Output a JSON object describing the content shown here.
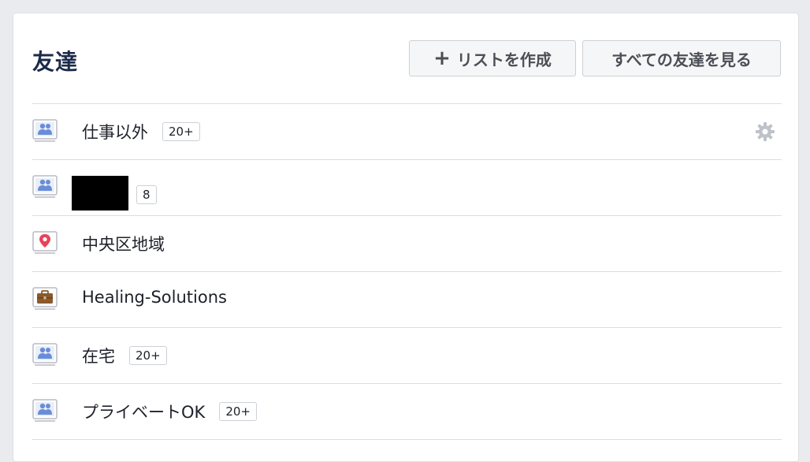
{
  "header": {
    "title": "友達",
    "create_list_label": "リストを作成",
    "see_all_label": "すべての友達を見る"
  },
  "lists": [
    {
      "label": "仕事以外",
      "badge": "20+",
      "icon": "friends-list-icon",
      "gear": true
    },
    {
      "label": "",
      "badge": "8",
      "icon": "friends-list-icon",
      "redacted": true
    },
    {
      "label": "中央区地域",
      "badge": "",
      "icon": "location-pin-icon"
    },
    {
      "label": "Healing-Solutions",
      "badge": "",
      "icon": "briefcase-icon"
    },
    {
      "label": "在宅",
      "badge": "20+",
      "icon": "friends-list-icon"
    },
    {
      "label": "プライベートOK",
      "badge": "20+",
      "icon": "friends-list-icon"
    }
  ],
  "colors": {
    "accent_blue": "#6a8dd8",
    "pin_red": "#e8435a",
    "briefcase_brown": "#8a5a2b",
    "title_navy": "#1c2b4a"
  }
}
